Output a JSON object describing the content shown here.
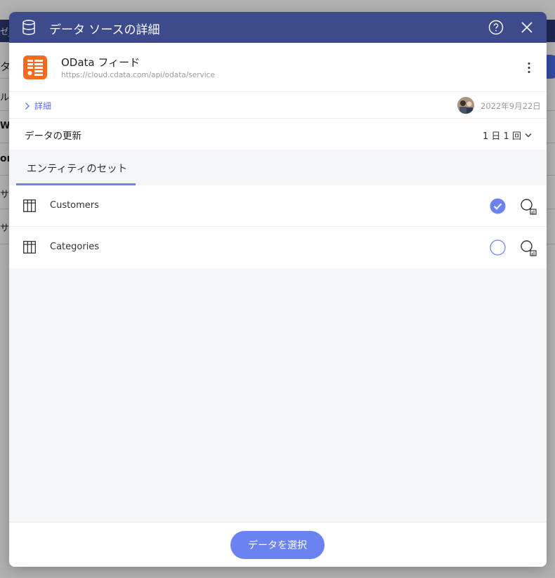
{
  "background": {
    "header_fragment": "ゼ_",
    "rows": [
      "タ",
      "ル",
      "W",
      "or",
      "サ",
      "サ"
    ]
  },
  "dialog": {
    "title": "データ ソースの詳細",
    "source": {
      "name": "OData フィード",
      "url": "https://cloud.cdata.com/api/odata/service"
    },
    "details_link": "詳細",
    "date": "2022年9月22日",
    "refresh": {
      "label": "データの更新",
      "value": "1 日 1 回"
    },
    "tab_label": "エンティティのセット",
    "entities": [
      {
        "name": "Customers",
        "selected": true
      },
      {
        "name": "Categories",
        "selected": false
      }
    ],
    "select_button": "データを選択"
  },
  "colors": {
    "header": "#3d4a8c",
    "accent": "#6b82f0",
    "logo": "#f26b21"
  }
}
